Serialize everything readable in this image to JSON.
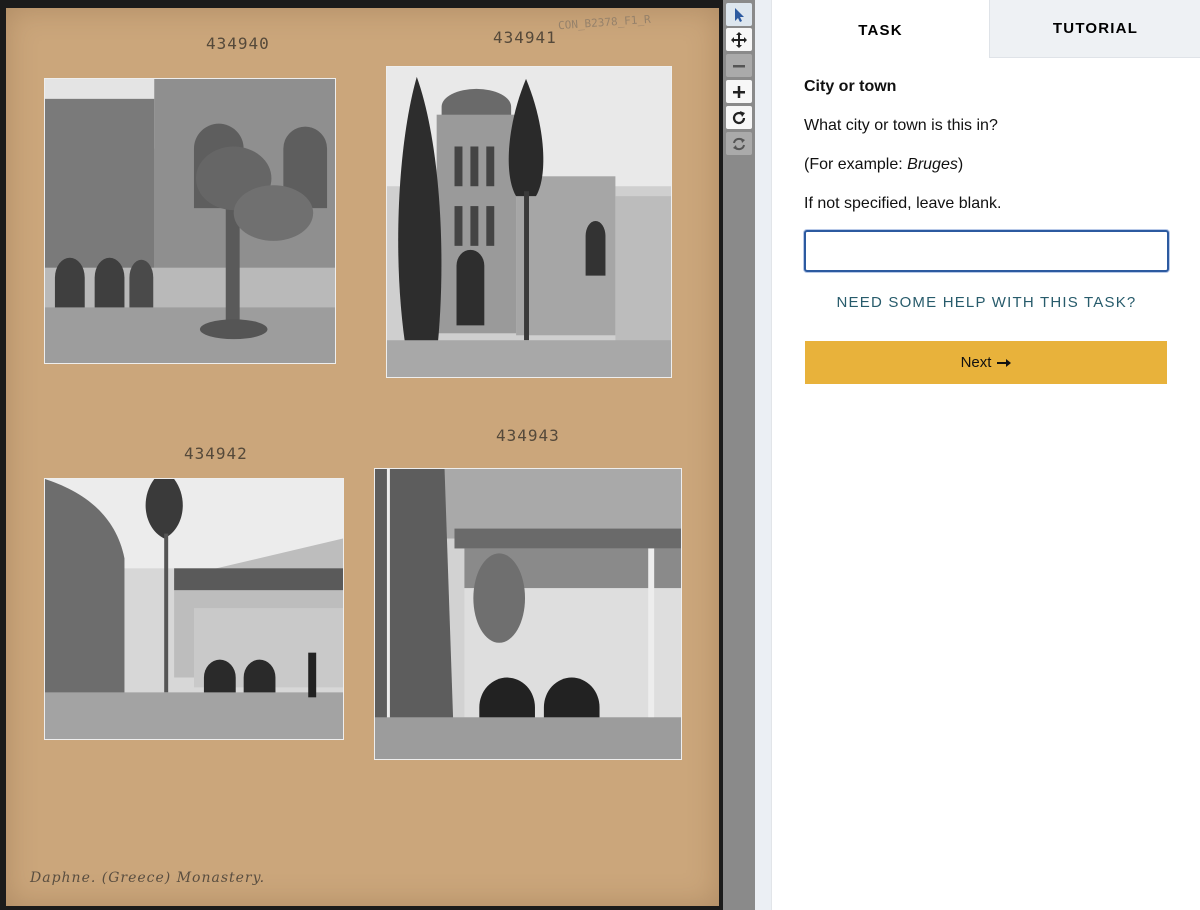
{
  "viewer": {
    "sheet": {
      "reference_code": "CON_B2378_F1_R",
      "caption": "Daphne. (Greece) Monastery.",
      "photos": [
        {
          "accession": "434940"
        },
        {
          "accession": "434941"
        },
        {
          "accession": "434942"
        },
        {
          "accession": "434943"
        }
      ]
    }
  },
  "toolbar": {
    "tools": [
      {
        "icon": "pointer-icon",
        "label": "Annotate",
        "active": true
      },
      {
        "icon": "move-icon",
        "label": "Move"
      },
      {
        "icon": "zoom-out-icon",
        "label": "Zoom out",
        "disabled": true
      },
      {
        "icon": "zoom-in-icon",
        "label": "Zoom in"
      },
      {
        "icon": "rotate-icon",
        "label": "Rotate"
      },
      {
        "icon": "reset-icon",
        "label": "Reset",
        "disabled": true
      }
    ]
  },
  "panel": {
    "tabs": [
      {
        "label": "TASK",
        "active": true
      },
      {
        "label": "TUTORIAL",
        "active": false
      }
    ],
    "question": {
      "title": "City or town",
      "prompt": "What city or town is this in?",
      "example_prefix": "(For example: ",
      "example_value": "Bruges",
      "example_suffix": ")",
      "instruction": "If not specified, leave blank."
    },
    "answer_value": "",
    "help_link": "NEED SOME HELP WITH THIS TASK?",
    "next_label": "Next",
    "colors": {
      "accent_button": "#e8b23b",
      "link": "#275b6b",
      "focus_border": "#2c5aa0",
      "sheet": "#cba67b"
    }
  }
}
